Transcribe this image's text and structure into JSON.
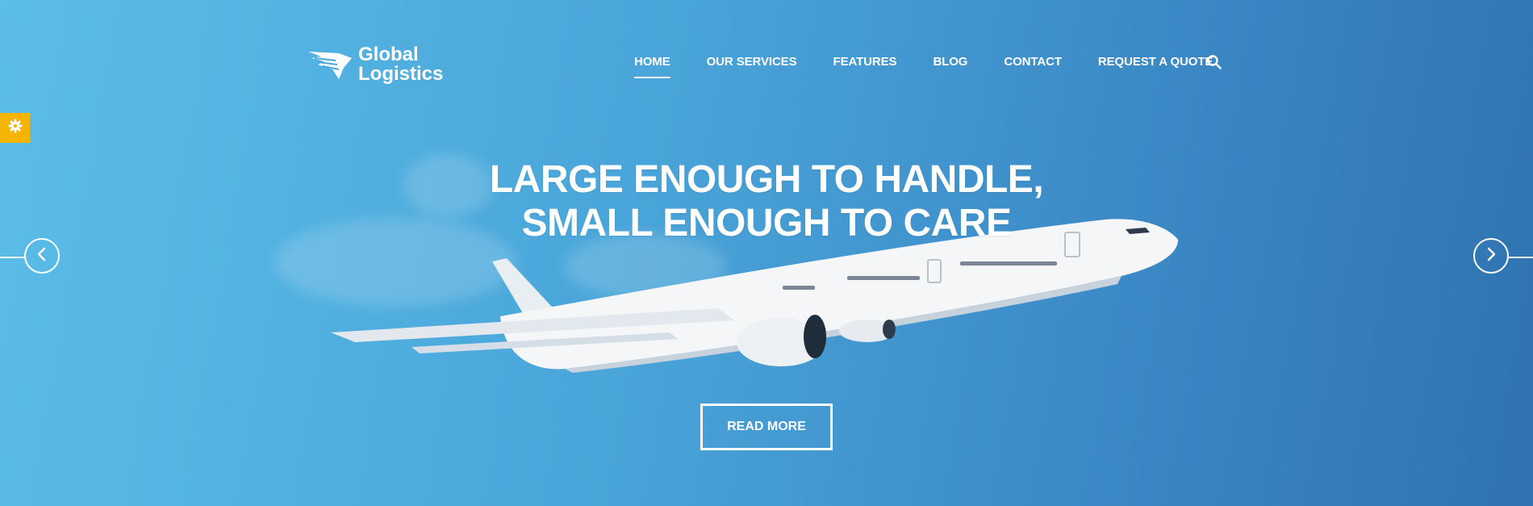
{
  "brand": {
    "name_line1": "Global",
    "name_line2": "Logistics",
    "logo_icon": "wing-icon"
  },
  "nav": {
    "items": [
      {
        "label": "HOME",
        "active": true
      },
      {
        "label": "OUR SERVICES",
        "active": false
      },
      {
        "label": "FEATURES",
        "active": false
      },
      {
        "label": "BLOG",
        "active": false
      },
      {
        "label": "CONTACT",
        "active": false
      },
      {
        "label": "REQUEST A QUOTE",
        "active": false
      }
    ],
    "search_icon": "search-icon"
  },
  "settings_tab": {
    "icon": "gear-icon",
    "color": "#f4b400"
  },
  "hero": {
    "headline_line1": "LARGE ENOUGH TO HANDLE,",
    "headline_line2": "SMALL ENOUGH TO CARE",
    "cta_label": "READ MORE",
    "image": "airplane-image"
  },
  "slider": {
    "prev_icon": "chevron-left-icon",
    "next_icon": "chevron-right-icon"
  },
  "colors": {
    "background_start": "#5bbde8",
    "background_end": "#2f73b0",
    "accent": "#f4b400",
    "text": "#ffffff"
  }
}
